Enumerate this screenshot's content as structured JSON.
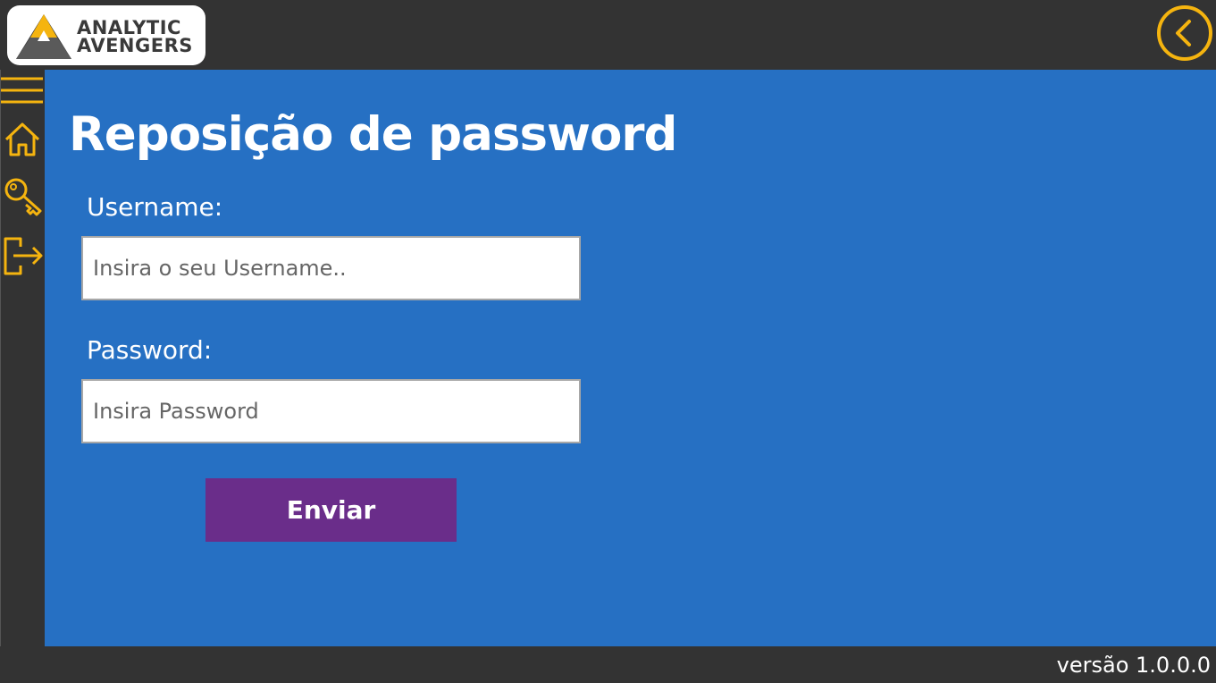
{
  "header": {
    "logo_line1": "ANALYTIC",
    "logo_line2": "AVENGERS",
    "back_icon": "chevron-left-circle-icon"
  },
  "sidebar": {
    "items": [
      {
        "icon": "menu-icon"
      },
      {
        "icon": "home-icon"
      },
      {
        "icon": "key-icon"
      },
      {
        "icon": "logout-icon"
      }
    ]
  },
  "main": {
    "title": "Reposição de password",
    "username_label": "Username:",
    "username_placeholder": "Insira o seu Username..",
    "username_value": "",
    "password_label": "Password:",
    "password_placeholder": "Insira Password",
    "password_value": "",
    "submit_label": "Enviar"
  },
  "footer": {
    "version": "versão 1.0.0.0"
  },
  "colors": {
    "background_dark": "#333333",
    "panel_blue": "#2670c3",
    "accent_yellow": "#f5b40f",
    "button_purple": "#6a2d8a",
    "text_white": "#ffffff"
  }
}
